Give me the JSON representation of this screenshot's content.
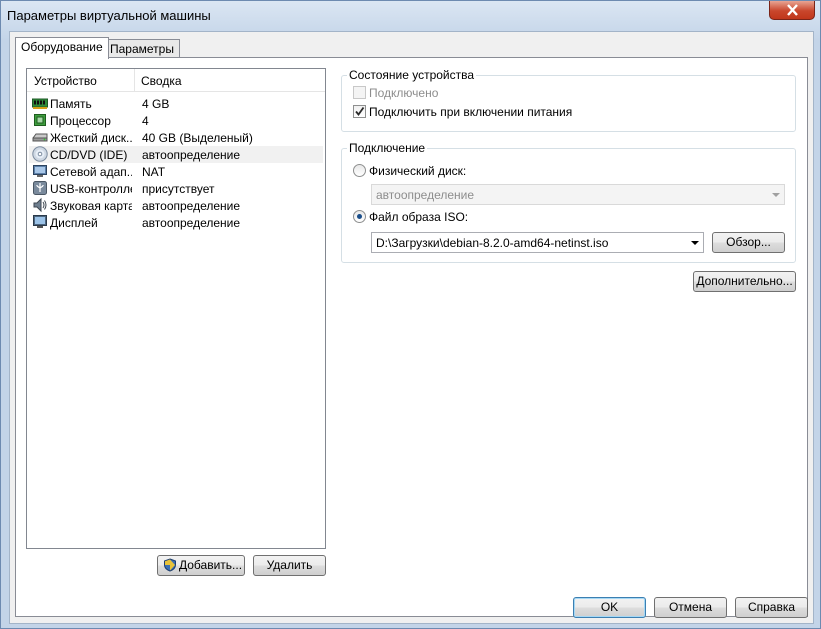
{
  "window": {
    "title": "Параметры виртуальной машины"
  },
  "tabs": [
    {
      "label": "Оборудование",
      "active": true
    },
    {
      "label": "Параметры",
      "active": false
    }
  ],
  "device_list": {
    "columns": [
      "Устройство",
      "Сводка"
    ],
    "rows": [
      {
        "name": "Память",
        "summary": "4 GB",
        "icon": "memory-icon"
      },
      {
        "name": "Процессор",
        "summary": "4",
        "icon": "processor-icon"
      },
      {
        "name": "Жесткий диск...",
        "summary": "40 GB (Выделеный)",
        "icon": "hard-disk-icon"
      },
      {
        "name": "CD/DVD (IDE)",
        "summary": "автоопределение",
        "icon": "cd-dvd-icon",
        "selected": true
      },
      {
        "name": "Сетевой адап...",
        "summary": "NAT",
        "icon": "network-adapter-icon"
      },
      {
        "name": "USB-контроллер",
        "summary": "присутствует",
        "icon": "usb-icon"
      },
      {
        "name": "Звуковая карта",
        "summary": "автоопределение",
        "icon": "sound-card-icon"
      },
      {
        "name": "Дисплей",
        "summary": "автоопределение",
        "icon": "display-icon"
      }
    ],
    "add_label": "Добавить...",
    "remove_label": "Удалить"
  },
  "device_status": {
    "title": "Состояние устройства",
    "connected_label": "Подключено",
    "connected_checked": false,
    "connect_on_power_label": "Подключить при включении питания",
    "connect_on_power_checked": true
  },
  "connection": {
    "title": "Подключение",
    "physical_label": "Физический диск:",
    "physical_value": "автоопределение",
    "iso_label": "Файл образа ISO:",
    "iso_value": "D:\\Загрузки\\debian-8.2.0-amd64-netinst.iso",
    "browse_label": "Обзор...",
    "selected": "iso"
  },
  "advanced_label": "Дополнительно...",
  "footer": {
    "ok": "OK",
    "cancel": "Отмена",
    "help": "Справка"
  }
}
